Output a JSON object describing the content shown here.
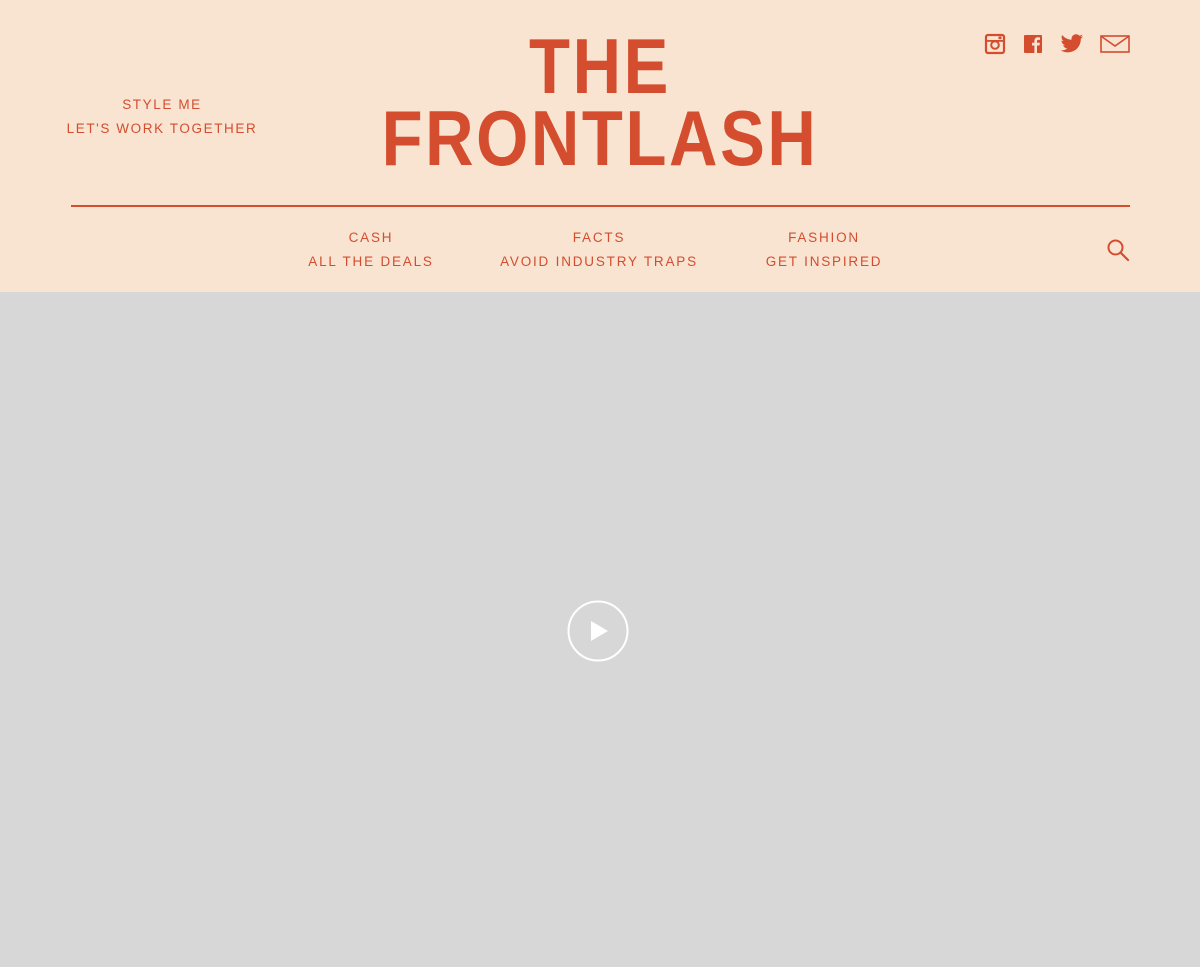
{
  "brand": {
    "line1": "THE",
    "line2": "FRONTLASH",
    "accent_color": "#d44d2f",
    "header_background": "#f8e4d1"
  },
  "left_links": [
    {
      "label": "STYLE ME"
    },
    {
      "label": "LET'S WORK TOGETHER"
    }
  ],
  "social": [
    {
      "icon": "instagram-icon"
    },
    {
      "icon": "facebook-icon"
    },
    {
      "icon": "twitter-icon"
    },
    {
      "icon": "mail-icon"
    }
  ],
  "nav": [
    {
      "title": "CASH",
      "subtitle": "ALL THE DEALS"
    },
    {
      "title": "FACTS",
      "subtitle": "AVOID INDUSTRY TRAPS"
    },
    {
      "title": "FASHION",
      "subtitle": "GET INSPIRED"
    }
  ],
  "search": {
    "icon": "search-icon"
  },
  "video": {
    "background": "#d7d7d7",
    "play_icon": "play-icon"
  }
}
